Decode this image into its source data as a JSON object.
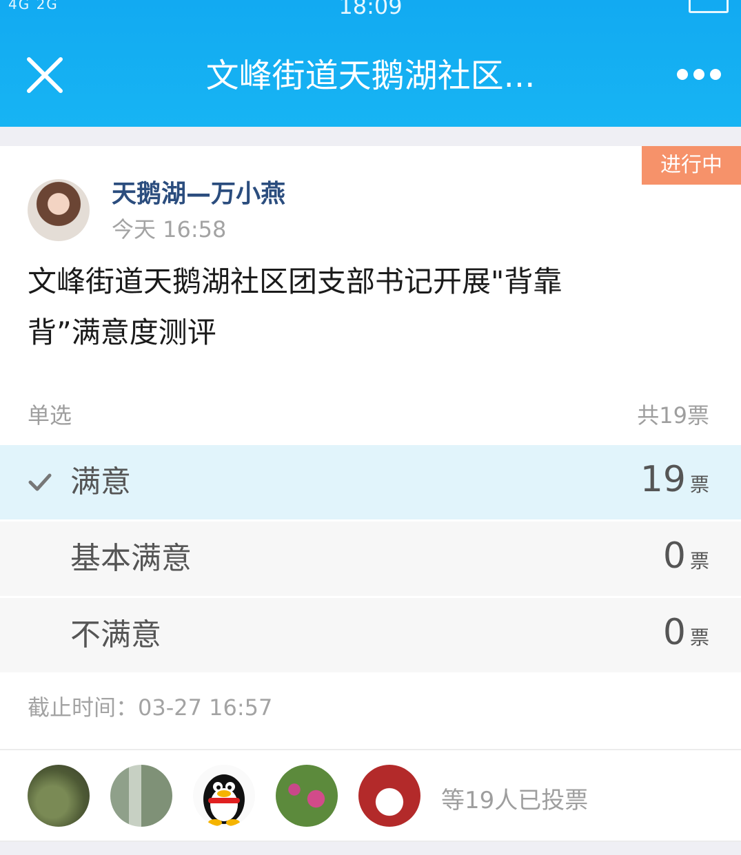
{
  "status_bar": {
    "time": "18:09",
    "signal": "4G 2G",
    "battery_icon": "battery-icon"
  },
  "nav": {
    "title": "文峰街道天鹅湖社区...",
    "close_icon": "close-icon",
    "more_icon": "more-dots-icon"
  },
  "post": {
    "status_badge": "进行中",
    "author": "天鹅湖—万小燕",
    "time": "今天 16:58",
    "question_line1": "文峰街道天鹅湖社区团支部书记开展\"背靠",
    "question_line2": "背”满意度测评",
    "vote_type": "单选",
    "total_votes": "共19票"
  },
  "options": [
    {
      "label": "满意",
      "count": "19",
      "unit": "票",
      "selected": true
    },
    {
      "label": "基本满意",
      "count": "0",
      "unit": "票",
      "selected": false
    },
    {
      "label": "不满意",
      "count": "0",
      "unit": "票",
      "selected": false
    }
  ],
  "deadline": "截止时间：03-27 16:57",
  "voters_text": "等19人已投票",
  "colors": {
    "nav_blue": "#12aaf2",
    "badge_orange": "#f6926a",
    "selected_bg": "#e1f4fb",
    "author_blue": "#2b4d7e"
  }
}
